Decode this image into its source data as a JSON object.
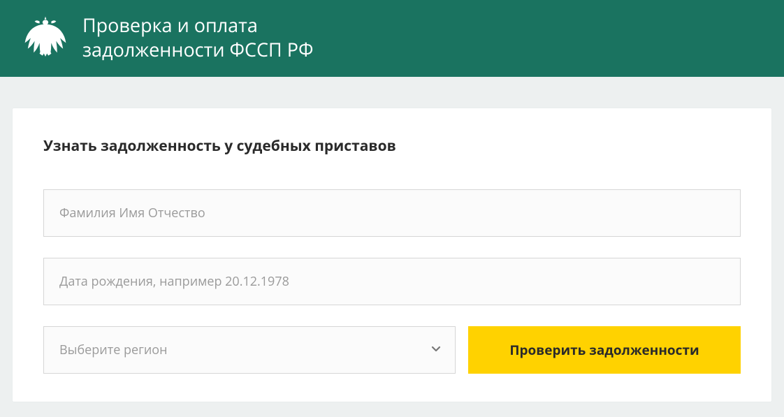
{
  "header": {
    "title_line1": "Проверка и оплата",
    "title_line2": "задолженности ФССП РФ"
  },
  "card": {
    "title": "Узнать задолженность у судебных приставов"
  },
  "form": {
    "name_placeholder": "Фамилия Имя Отчество",
    "dob_placeholder": "Дата рождения, например 20.12.1978",
    "region_placeholder": "Выберите регион",
    "submit_label": "Проверить задолженности"
  },
  "colors": {
    "header_bg": "#1a7360",
    "page_bg": "#edf0f0",
    "card_bg": "#ffffff",
    "button_bg": "#ffd200"
  }
}
